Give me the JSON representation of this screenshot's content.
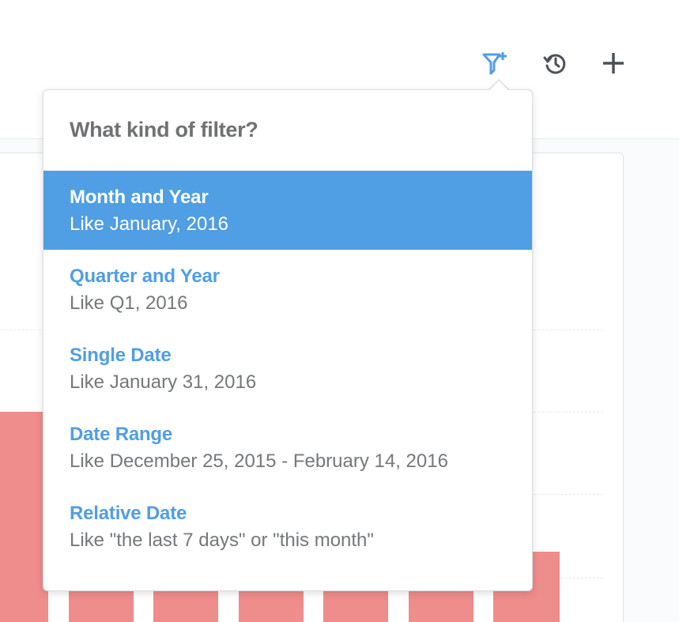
{
  "toolbar": {
    "icons": [
      "add-filter-icon",
      "history-icon",
      "plus-icon"
    ],
    "accent_color": "#509ee3",
    "icon_color": "#4c5158"
  },
  "popover": {
    "title": "What kind of filter?",
    "selected_index": 0,
    "options": [
      {
        "label": "Month and Year",
        "example": "Like January, 2016"
      },
      {
        "label": "Quarter and Year",
        "example": "Like Q1, 2016"
      },
      {
        "label": "Single Date",
        "example": "Like January 31, 2016"
      },
      {
        "label": "Date Range",
        "example": "Like December 25, 2015 - February 14, 2016"
      },
      {
        "label": "Relative Date",
        "example": "Like \"the last 7 days\" or \"this month\""
      }
    ]
  },
  "colors": {
    "accent": "#509ee3",
    "bar": "#ef8c8c",
    "title_text": "#6f7174",
    "example_text": "#74787c"
  }
}
